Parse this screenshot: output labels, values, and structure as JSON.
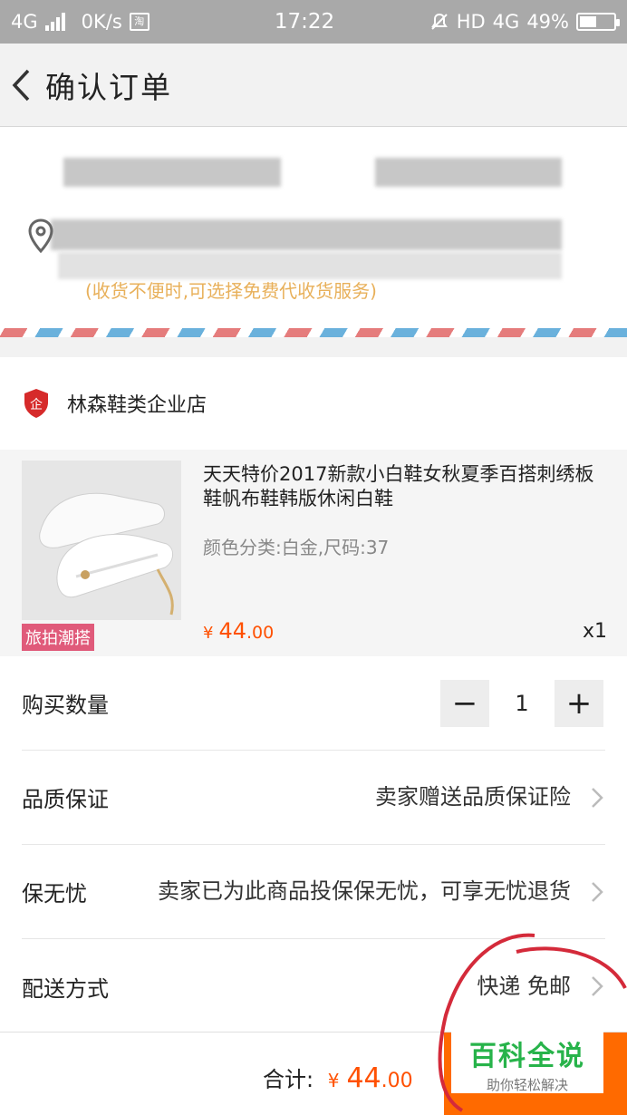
{
  "status_bar": {
    "network_type": "4G",
    "speed": "0K/s",
    "taobao_icon": "淘",
    "time": "17:22",
    "hd_label": "HD",
    "network_right": "4G",
    "battery": "49%"
  },
  "header": {
    "title": "确认订单"
  },
  "address": {
    "note": "(收货不便时,可选择免费代收货服务)"
  },
  "shop": {
    "name": "林森鞋类企业店"
  },
  "product": {
    "title": "天天特价2017新款小白鞋女秋夏季百搭刺绣板鞋帆布鞋韩版休闲白鞋",
    "spec": "颜色分类:白金,尺码:37",
    "tag": "旅拍潮搭",
    "price_currency": "¥",
    "price_int": "44",
    "price_dec": ".00",
    "quantity": "x1"
  },
  "rows": {
    "qty_label": "购买数量",
    "qty_minus": "−",
    "qty_value": "1",
    "qty_plus": "+",
    "quality_label": "品质保证",
    "quality_value": "卖家赠送品质保证险",
    "worry_label": "保无忧",
    "worry_value": "卖家已为此商品投保保无忧，可享无忧退货",
    "delivery_label": "配送方式",
    "delivery_value": "快递 免邮"
  },
  "footer": {
    "total_label": "合计:",
    "total_currency": "¥",
    "total_int": "44",
    "total_dec": ".00"
  },
  "watermark": {
    "title": "百科全说",
    "subtitle": "助你轻松解决"
  },
  "colors": {
    "accent": "#ff5000",
    "submit": "#ff6a00",
    "watermark_green": "#27b34a",
    "note": "#e8b05a"
  }
}
